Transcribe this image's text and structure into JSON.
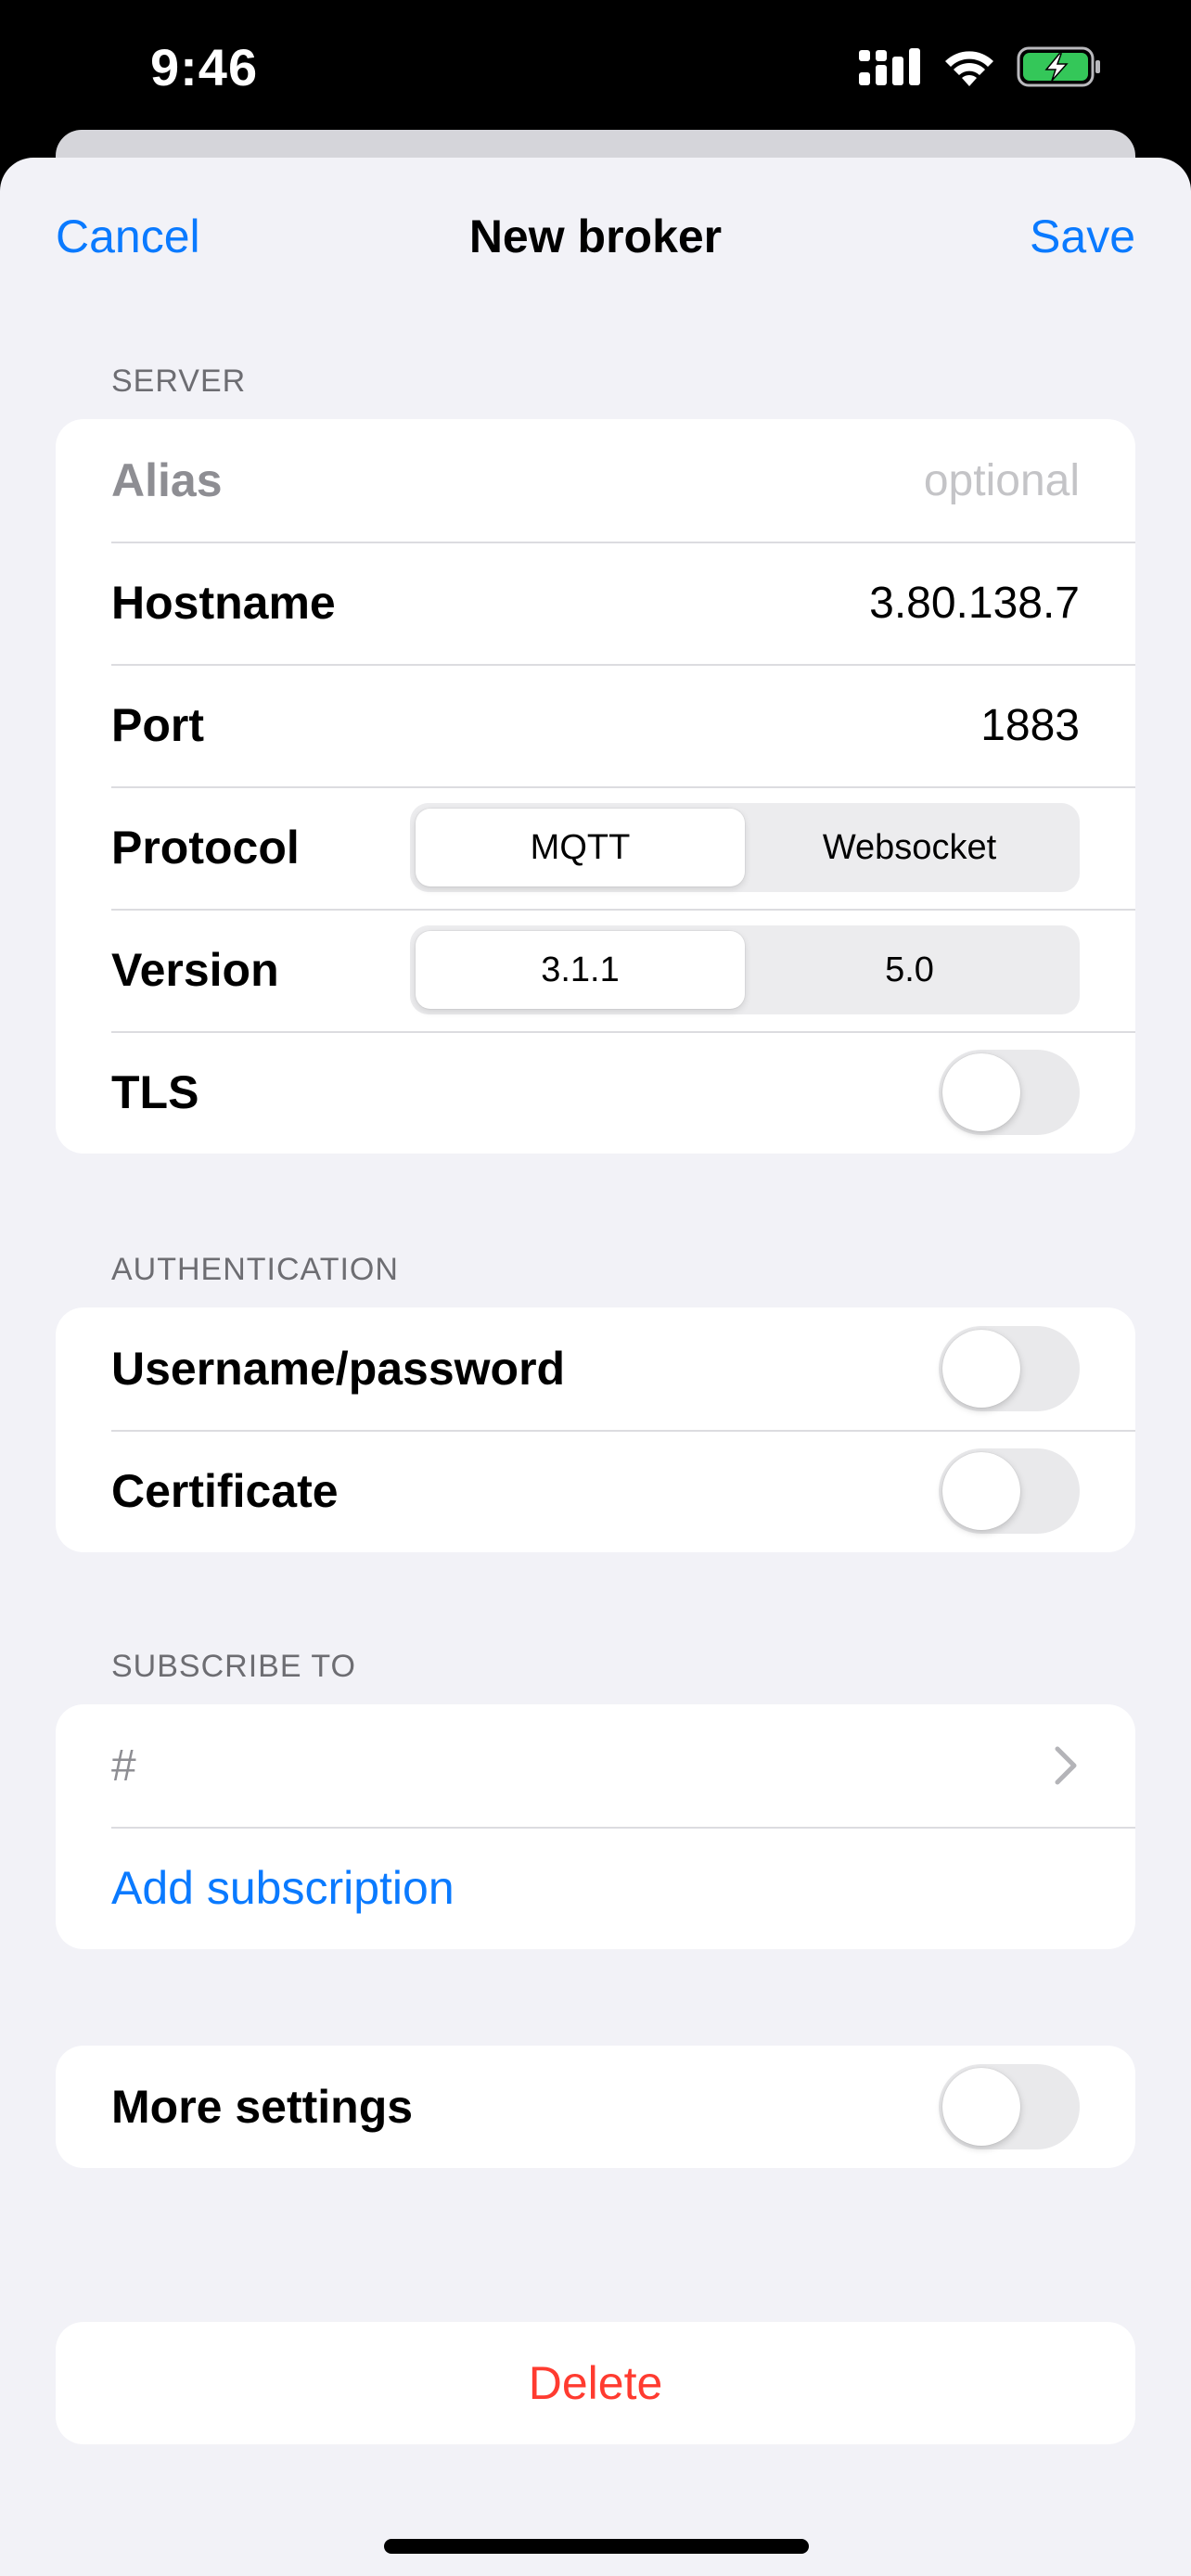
{
  "status_bar": {
    "time": "9:46"
  },
  "nav": {
    "cancel": "Cancel",
    "title": "New broker",
    "save": "Save"
  },
  "server": {
    "header": "SERVER",
    "alias_label": "Alias",
    "alias_placeholder": "optional",
    "hostname_label": "Hostname",
    "hostname_value": "3.80.138.7",
    "port_label": "Port",
    "port_value": "1883",
    "protocol_label": "Protocol",
    "protocol_options": [
      "MQTT",
      "Websocket"
    ],
    "protocol_selected": "MQTT",
    "version_label": "Version",
    "version_options": [
      "3.1.1",
      "5.0"
    ],
    "version_selected": "3.1.1",
    "tls_label": "TLS",
    "tls_enabled": false
  },
  "authentication": {
    "header": "AUTHENTICATION",
    "userpass_label": "Username/password",
    "userpass_enabled": false,
    "certificate_label": "Certificate",
    "certificate_enabled": false
  },
  "subscribe": {
    "header": "SUBSCRIBE TO",
    "topic": "#",
    "add_label": "Add subscription"
  },
  "more_settings": {
    "label": "More settings",
    "enabled": false
  },
  "delete": {
    "label": "Delete"
  },
  "colors": {
    "accent": "#0a7aff",
    "destructive": "#ff3b30",
    "battery": "#34c759",
    "background": "#f2f2f7"
  }
}
